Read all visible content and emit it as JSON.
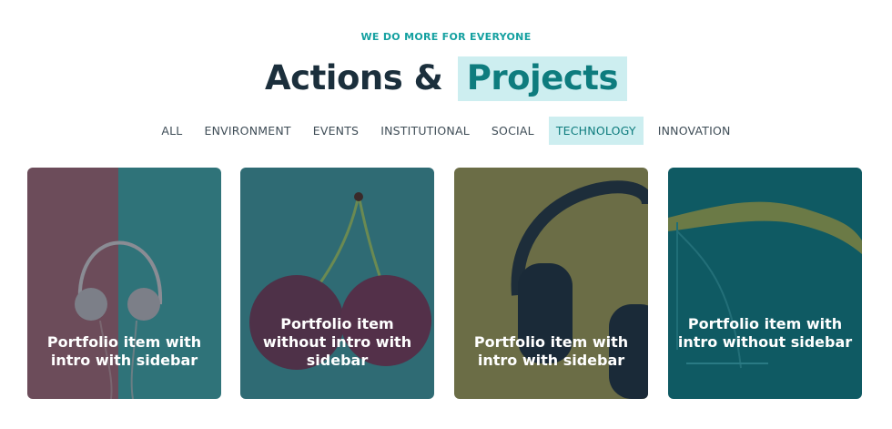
{
  "header": {
    "eyebrow": "WE DO MORE FOR EVERYONE",
    "title_main": "Actions &",
    "title_highlight": "Projects"
  },
  "filters": [
    {
      "label": "ALL",
      "active": false
    },
    {
      "label": "ENVIRONMENT",
      "active": false
    },
    {
      "label": "EVENTS",
      "active": false
    },
    {
      "label": "INSTITUTIONAL",
      "active": false
    },
    {
      "label": "SOCIAL",
      "active": false
    },
    {
      "label": "TECHNOLOGY",
      "active": true
    },
    {
      "label": "INNOVATION",
      "active": false
    }
  ],
  "cards": [
    {
      "title": "Portfolio item with intro with sidebar",
      "image": "headphones-white"
    },
    {
      "title": "Portfolio item without intro with sidebar",
      "image": "cherries"
    },
    {
      "title": "Portfolio item with intro with sidebar",
      "image": "headphones-dark"
    },
    {
      "title": "Portfolio item with intro without sidebar",
      "image": "glass-splash"
    }
  ],
  "colors": {
    "accent": "#14a0a0",
    "highlight_bg": "#cdeef0",
    "heading": "#1b2f3c"
  }
}
